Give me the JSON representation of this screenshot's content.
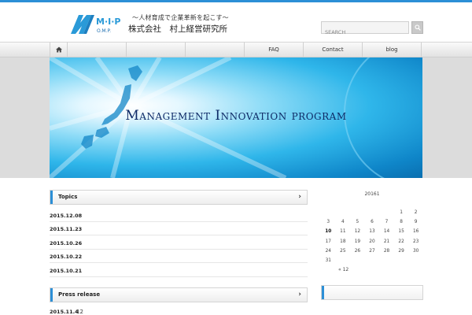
{
  "header": {
    "logo_letters": "M·I·P",
    "logo_sub": "O.M.P.",
    "tagline": "〜人材育成で企業革新を起こす〜",
    "company": "株式会社　村上経営研究所",
    "search_placeholder": "SEARCH"
  },
  "colors": {
    "accent": "#2c8fd6",
    "banner_text": "#0e2a66"
  },
  "nav": {
    "home_icon": "home-icon",
    "items": [
      {
        "label": "FAQ"
      },
      {
        "label": "Contact"
      },
      {
        "label": "blog"
      }
    ]
  },
  "banner": {
    "title": "Management Innovation program"
  },
  "topics": {
    "heading": "Topics",
    "items": [
      "2015.12.08",
      "2015.11.23",
      "2015.10.26",
      "2015.10.22",
      "2015.10.21"
    ]
  },
  "press": {
    "heading": "Press release",
    "items": [
      {
        "date": "2015.11.4",
        "text": "12"
      }
    ]
  },
  "calendar": {
    "caption": "20161",
    "weeks": [
      [
        "",
        "",
        "",
        "",
        "",
        "1",
        "2"
      ],
      [
        "3",
        "4",
        "5",
        "6",
        "7",
        "8",
        "9"
      ],
      [
        "10",
        "11",
        "12",
        "13",
        "14",
        "15",
        "16"
      ],
      [
        "17",
        "18",
        "19",
        "20",
        "21",
        "22",
        "23"
      ],
      [
        "24",
        "25",
        "26",
        "27",
        "28",
        "29",
        "30"
      ],
      [
        "31",
        "",
        "",
        "",
        "",
        "",
        ""
      ]
    ],
    "today": "10",
    "prev_link": "« 12"
  }
}
